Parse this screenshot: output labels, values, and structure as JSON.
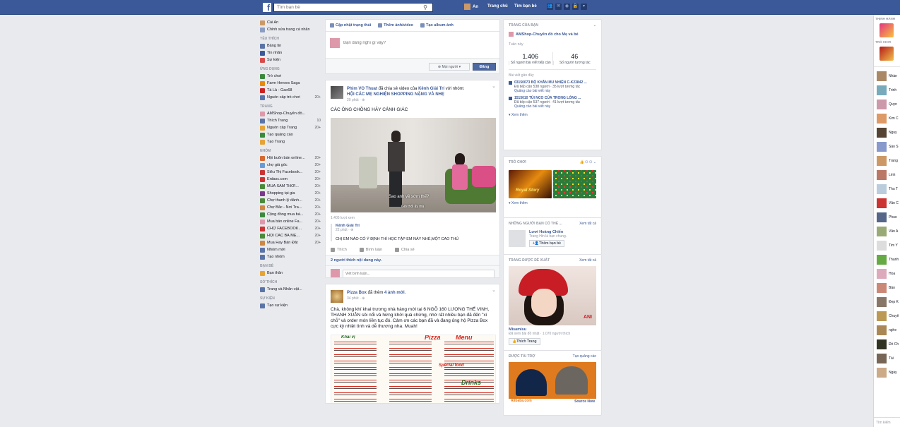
{
  "topbar": {
    "logo": "f",
    "search_placeholder": "Tìm bạn bè",
    "user_name": "An",
    "home": "Trang chủ",
    "find_friends": "Tìm bạn bè"
  },
  "leftnav": {
    "profile": [
      {
        "label": "Cái An",
        "color": "#c96"
      },
      {
        "label": "Chỉnh sửa trang cá nhân",
        "color": "#8b9dc3"
      }
    ],
    "sections": [
      {
        "title": "YÊU THÍCH",
        "items": [
          {
            "label": "Bảng tin",
            "count": "",
            "color": "#5b74a8"
          },
          {
            "label": "Tin nhắn",
            "count": "",
            "color": "#3b5998"
          },
          {
            "label": "Sự kiện",
            "count": "",
            "color": "#d94b4b"
          }
        ]
      },
      {
        "title": "ỨNG DỤNG",
        "items": [
          {
            "label": "Trò chơi",
            "count": "",
            "color": "#3b8a3b"
          },
          {
            "label": "Farm Heroes Saga",
            "count": "",
            "color": "#e68b10"
          },
          {
            "label": "Tá Lả - Gao68",
            "count": "",
            "color": "#c22"
          },
          {
            "label": "Nguồn cấp trò chơi",
            "count": "20+",
            "color": "#5b74a8"
          }
        ]
      },
      {
        "title": "TRANG",
        "items": [
          {
            "label": "AMShop-Chuyên đồ...",
            "count": "",
            "color": "#d9a"
          },
          {
            "label": "Thích Trang",
            "count": "10",
            "color": "#5b74a8"
          },
          {
            "label": "Nguồn cấp Trang",
            "count": "20+",
            "color": "#e5a437"
          },
          {
            "label": "Tạo quảng cáo",
            "count": "",
            "color": "#3b8a3b"
          },
          {
            "label": "Tạo Trang",
            "count": "",
            "color": "#e5a437"
          }
        ]
      },
      {
        "title": "NHÓM",
        "items": [
          {
            "label": "Hội buôn bán online...",
            "count": "20+",
            "color": "#d46a2f"
          },
          {
            "label": "chợ giá gốc",
            "count": "20+",
            "color": "#6a9ad4"
          },
          {
            "label": "Siêu Thị Facebook...",
            "count": "20+",
            "color": "#c33"
          },
          {
            "label": "Erdasc.com",
            "count": "20+",
            "color": "#c33"
          },
          {
            "label": "MUA SẮM THỜI...",
            "count": "20+",
            "color": "#4a8a3a"
          },
          {
            "label": "Shopping tại gia",
            "count": "20+",
            "color": "#7a3a8a"
          },
          {
            "label": "Chợ thanh lý đánh...",
            "count": "20+",
            "color": "#4a8a3a"
          },
          {
            "label": "Chợ Bắc - Nơi Tra...",
            "count": "20+",
            "color": "#c84"
          },
          {
            "label": "Cộng đồng mua bá...",
            "count": "20+",
            "color": "#3b8a3b"
          },
          {
            "label": "Mua bán online Fa...",
            "count": "20+",
            "color": "#d9a"
          },
          {
            "label": "CHỢ FACEBOOK...",
            "count": "20+",
            "color": "#c33"
          },
          {
            "label": "HỘI CÁC BÀ MẸ...",
            "count": "20+",
            "color": "#4a8a3a"
          },
          {
            "label": "Mua Hay Bán Đắt",
            "count": "20+",
            "color": "#c84"
          },
          {
            "label": "Nhóm mới",
            "count": "",
            "color": "#5b74a8"
          },
          {
            "label": "Tạo nhóm",
            "count": "",
            "color": "#5b74a8"
          }
        ]
      },
      {
        "title": "BẠN BÈ",
        "items": [
          {
            "label": "Bạn thân",
            "count": "",
            "color": "#e5a437"
          }
        ]
      },
      {
        "title": "SỞ THÍCH",
        "items": [
          {
            "label": "Trang và Nhân vật...",
            "count": "",
            "color": "#5b74a8"
          }
        ]
      },
      {
        "title": "SỰ KIỆN",
        "items": [
          {
            "label": "Tạo sự kiện",
            "count": "",
            "color": "#5b74a8"
          }
        ]
      }
    ]
  },
  "composer": {
    "tab_status": "Cập nhật trạng thái",
    "tab_photo": "Thêm ảnh/video",
    "tab_album": "Tạo album ảnh",
    "placeholder": "Bạn đang nghĩ gì vậy?",
    "audience": "Mọi người",
    "post_button": "Đăng"
  },
  "post1": {
    "author": "Phim VO Thuat",
    "action": " đã chia sẻ video của ",
    "target": "Kênh Giải Trí",
    "action2": " với nhóm: ",
    "group": "HỘI CÁC MẸ NGHIỆN SHOPPING NẶNG VÀ NHẸ",
    "time": "20 phút · ",
    "text": "CÁC ÔNG CHỒNG HÃY CẢNH GIÁC",
    "subtitle": "Sao anh về sớm thế?",
    "subtitle2": "Gió thổi ấy mà",
    "views": "1.405 lượt xem",
    "shared_name": "Kênh Giải Trí",
    "shared_time": "22 phút · ",
    "shared_text": "CHỊ EM NÀO CÓ Ý ĐỊNH THÌ HỌC TẬP EM NÀY NHÉ,MỘT CAO THỦ",
    "like": "Thích",
    "comment": "Bình luận",
    "share": "Chia sẻ",
    "likes_summary": "2 người thích nội dung này.",
    "comment_placeholder": "Viết bình luận..."
  },
  "post2": {
    "author": "Pizza Box",
    "action": " đã thêm ",
    "count": "4 ảnh mới",
    "action_end": ".",
    "time": "34 phút · ",
    "text": "Chà, không khí khai trương nhà hàng mới tại 6 NGÕ 160 LƯƠNG THẾ VINH, THANH XUÂN sôi nổi và hừng khởi quá chừng, nhờ rất nhiều bạn đã đến \"xí chỗ\" và order món liền tục đó. Cảm ơn các bạn đã và đang ủng hộ Pizza Box cực kỳ nhiệt tình và dễ thương nha. Muah!",
    "menu_title1": "Khai vị",
    "menu_title2": "Pizza",
    "menu_title3": "Menu",
    "menu_title4": "Drinks",
    "menu_title5": "Special food"
  },
  "right": {
    "pages_head": "TRANG CỦA BẠN",
    "page_name": "AMShop-Chuyên đồ cho Mẹ và bé",
    "week": "Tuần này",
    "reach_num": "1.406",
    "reach_label": "Số người bài viết tiếp cận",
    "notif_num": "46",
    "notif_label": "Số người tương tác",
    "recent": "Bài viết gần đây",
    "posts": [
      {
        "title": "03150073 BỘ KHĂN MU NHIỆN C-K23842 ...",
        "reach": "Đã tiếp cận 538 người · 35 lượt tương tác",
        "boost": "Quảng cáo bài viết này"
      },
      {
        "title": "1515010 TÚI NCO CỦA TRONG LÒNG ...",
        "reach": "Đã tiếp cận 537 người · 41 lượt tương tác",
        "boost": "Quảng cáo bài viết này"
      }
    ],
    "see_more": "Xem thêm",
    "games_head": "TRÒ CHƠI",
    "game1_name": "Royal Story",
    "games_more": "Xem thêm",
    "pymk_head": "NHỮNG NGƯỜI BẠN CÓ THỂ ...",
    "see_all": "Xem tất cả",
    "pymk_name": "Lươi Hoàng Chiến",
    "pymk_mutual": "Trang Hin là bạn chung.",
    "add_friend": "Thêm bạn bè",
    "suggest_head": "TRANG ĐƯỢC ĐỀ XUẤT",
    "suggest_all": "Xem tất cả",
    "suggest_brand": "ANI",
    "suggest_name": "Misamisu",
    "suggest_meta": "Đã xem bài đồ nhật · 1.070 người thích",
    "like_page": "Thích Trang",
    "ad_head": "ĐƯỢC TÀI TRỢ",
    "ad_create": "Tạo quảng cáo",
    "ad_brand": "Alibaba.com",
    "ad_source": "Source Now"
  },
  "rightbar": {
    "trending": "THỊNH HÀNH",
    "games": "TRÒ CHƠI",
    "contacts": [
      {
        "name": "Nhàn",
        "color": "#a86"
      },
      {
        "name": "Trinh",
        "color": "#7ab"
      },
      {
        "name": "Quyn",
        "color": "#c9a"
      },
      {
        "name": "Kim C",
        "color": "#d96"
      },
      {
        "name": "Nguy",
        "color": "#543"
      },
      {
        "name": "Sáo S",
        "color": "#89c"
      },
      {
        "name": "Trang",
        "color": "#c96"
      },
      {
        "name": "Linh",
        "color": "#b76"
      },
      {
        "name": "Thu T",
        "color": "#bcd"
      },
      {
        "name": "Vân C",
        "color": "#c33"
      },
      {
        "name": "Phuo",
        "color": "#568"
      },
      {
        "name": "Vân A",
        "color": "#9a7"
      },
      {
        "name": "Tim Y",
        "color": "#ddd"
      },
      {
        "name": "Thanh",
        "color": "#6a4"
      },
      {
        "name": "Hoa",
        "color": "#dab"
      },
      {
        "name": "Bảo",
        "color": "#c87"
      },
      {
        "name": "Đẹp K",
        "color": "#876"
      },
      {
        "name": "Chuyê",
        "color": "#b95"
      },
      {
        "name": "nghe",
        "color": "#a85"
      },
      {
        "name": "Đồ Ch",
        "color": "#332"
      },
      {
        "name": "Tài",
        "color": "#765"
      },
      {
        "name": "Ngày",
        "color": "#ca8"
      }
    ],
    "search": "Tìm kiếm"
  },
  "colors": {
    "brand": "#3b5998",
    "background": "#e9eaed"
  }
}
